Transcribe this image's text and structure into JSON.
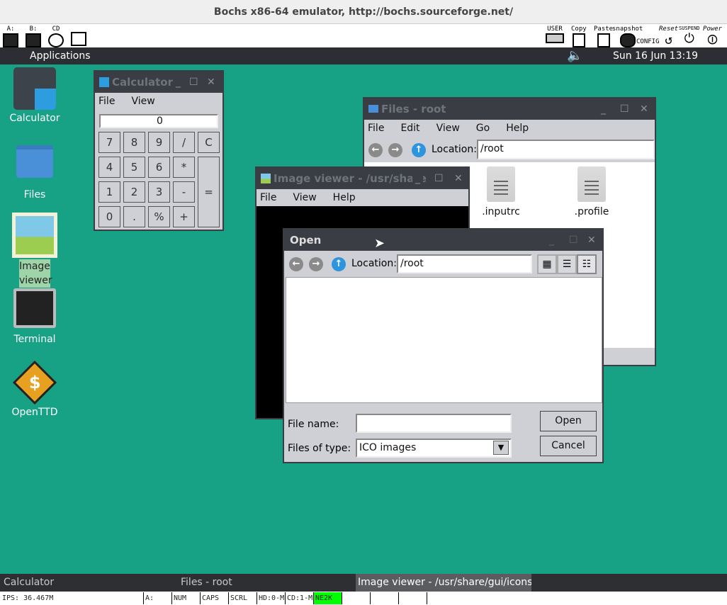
{
  "bochs": {
    "title": "Bochs x86-64 emulator, http://bochs.sourceforge.net/",
    "left_tools": [
      {
        "label": "A:",
        "icon": "floppy-a-icon"
      },
      {
        "label": "B:",
        "icon": "floppy-b-icon"
      },
      {
        "label": "CD",
        "icon": "cdrom-icon"
      },
      {
        "label": "",
        "icon": "mouse-icon"
      }
    ],
    "right_tools": [
      {
        "label": "USER",
        "icon": "keyboard-icon"
      },
      {
        "label": "Copy",
        "icon": "copy-icon"
      },
      {
        "label": "Paste",
        "icon": "paste-icon"
      },
      {
        "label": "snapshot",
        "icon": "camera-icon"
      },
      {
        "label": "CONFIG",
        "icon": "config-icon"
      },
      {
        "label": "Reset",
        "icon": "reset-icon"
      },
      {
        "label": "SUSPEND",
        "icon": "suspend-icon"
      },
      {
        "label": "Power",
        "icon": "power-icon"
      }
    ]
  },
  "panel": {
    "applications": "Applications",
    "clock": "Sun 16 Jun 13:19",
    "volume_icon": "speaker-icon"
  },
  "desktop": [
    {
      "label": "Calculator",
      "icon": "calculator-icon"
    },
    {
      "label": "Files",
      "icon": "folder-icon"
    },
    {
      "label": "Image viewer",
      "icon": "image-viewer-icon"
    },
    {
      "label": "Terminal",
      "icon": "terminal-icon"
    },
    {
      "label": "OpenTTD",
      "icon": "openttd-icon"
    }
  ],
  "calculator": {
    "title": "Calculator",
    "menu": [
      "File",
      "View"
    ],
    "display": "0",
    "keys": [
      "7",
      "8",
      "9",
      "/",
      "C",
      "4",
      "5",
      "6",
      "*",
      "1",
      "2",
      "3",
      "-",
      "0",
      ".",
      "%",
      "+"
    ],
    "equals": "="
  },
  "files": {
    "title": "Files - root",
    "menu": [
      "File",
      "Edit",
      "View",
      "Go",
      "Help"
    ],
    "location_label": "Location:",
    "location": "/root",
    "items": [
      ".inputrc",
      ".profile"
    ]
  },
  "imageviewer": {
    "title": "Image viewer - /usr/share",
    "menu": [
      "File",
      "View",
      "Help"
    ]
  },
  "open": {
    "title": "Open",
    "location_label": "Location:",
    "location": "/root",
    "filename_label": "File name:",
    "filename": "",
    "type_label": "Files of type:",
    "type": "ICO images",
    "open": "Open",
    "cancel": "Cancel"
  },
  "taskbar": [
    "Calculator",
    "Files - root",
    "Image viewer - /usr/share/gui/icons/("
  ],
  "status": {
    "ips": "IPS: 36.467M",
    "cells": [
      "A:",
      "NUM",
      "CAPS",
      "SCRL",
      "HD:0-M",
      "CD:1-M",
      "NE2K"
    ],
    "active_color": "#00ff00"
  }
}
